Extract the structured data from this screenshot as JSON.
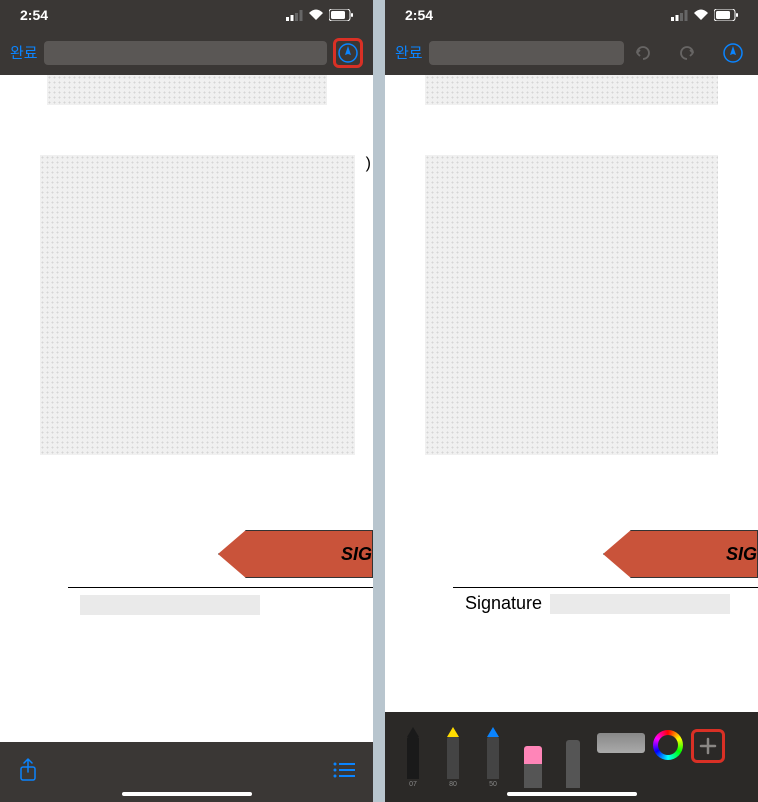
{
  "status": {
    "time": "2:54"
  },
  "toolbar": {
    "done": "완료",
    "markup_icon": "markup"
  },
  "document": {
    "banner_text": "SIG",
    "signature_label": "Signature"
  },
  "tools": {
    "pen_black": "07",
    "pen_yellow": "80",
    "pen_blue": "50"
  },
  "colors": {
    "accent_blue": "#0a84ff",
    "highlight_red": "#d93025",
    "banner_orange": "#c9533a"
  }
}
